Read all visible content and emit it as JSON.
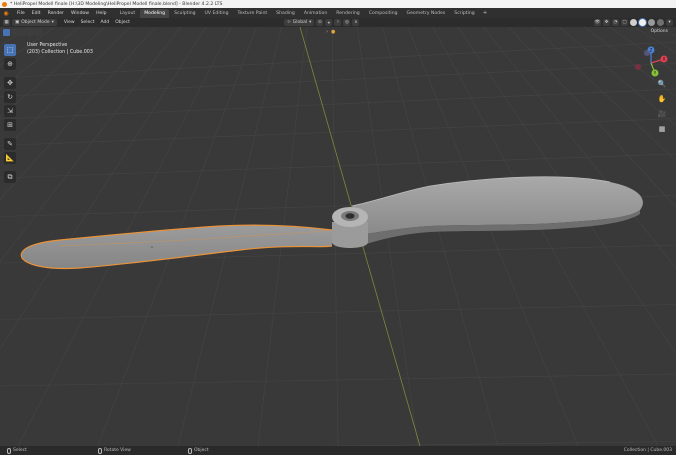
{
  "window": {
    "title": "* HeliPropel Modell finale [H:\\3D Modeling\\HeliPropel Modell finale.blend] - Blender 4.2.2 LTS"
  },
  "menubar": {
    "menus": [
      "File",
      "Edit",
      "Render",
      "Window",
      "Help"
    ],
    "workspaces": [
      "Layout",
      "Modeling",
      "Sculpting",
      "UV Editing",
      "Texture Paint",
      "Shading",
      "Animation",
      "Rendering",
      "Compositing",
      "Geometry Nodes",
      "Scripting"
    ],
    "active_workspace": "Modeling",
    "add_tab": "+"
  },
  "header": {
    "mode": "Object Mode",
    "menus": [
      "View",
      "Select",
      "Add",
      "Object"
    ],
    "orientation": "Global"
  },
  "subheader": {
    "options": "Options"
  },
  "viewport": {
    "view_name": "User Perspective",
    "collection_info": "(203) Collection | Cube.003",
    "background_color": "#393939",
    "grid_color": "#454545",
    "selection_outline_color": "#e8923a"
  },
  "gizmo": {
    "x": "X",
    "y": "Y",
    "z": "Z",
    "x_color": "#e0404f",
    "y_color": "#86c335",
    "z_color": "#4e82d8"
  },
  "toolbar": {
    "tools": [
      "select-box",
      "cursor",
      "move",
      "rotate",
      "scale",
      "transform",
      "annotate",
      "measure",
      "add-cube"
    ]
  },
  "statusbar": {
    "select": "Select",
    "rotate_view": "Rotate View",
    "object": "Object",
    "right": "Collection | Cube.003"
  }
}
